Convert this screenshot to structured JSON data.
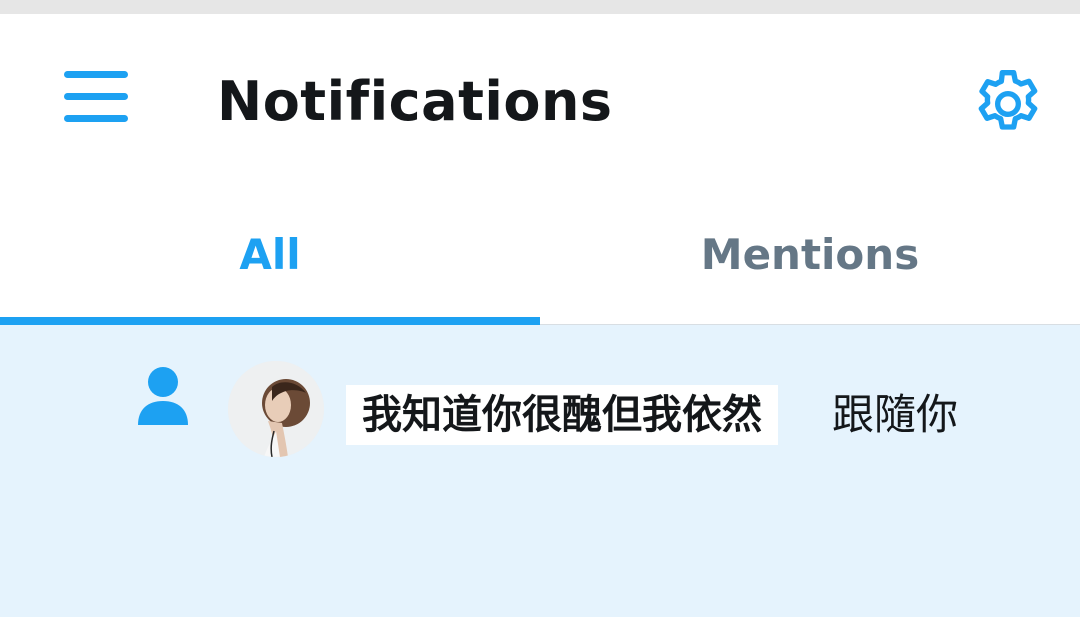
{
  "header": {
    "menu_icon": "hamburger-menu-icon",
    "title": "Notifications",
    "settings_icon": "gear-icon"
  },
  "tabs": [
    {
      "label": "All",
      "active": true
    },
    {
      "label": "Mentions",
      "active": false
    }
  ],
  "notifications": [
    {
      "type_icon": "person-icon",
      "avatar": "user-avatar",
      "user_name": "我知道你很醜但我依然",
      "action": "跟隨你"
    }
  ],
  "colors": {
    "accent": "#1da1f2",
    "title_text": "#14171a",
    "inactive_tab": "#657786",
    "unread_background": "#e5f3fd",
    "status_strip": "#e6e6e6"
  }
}
